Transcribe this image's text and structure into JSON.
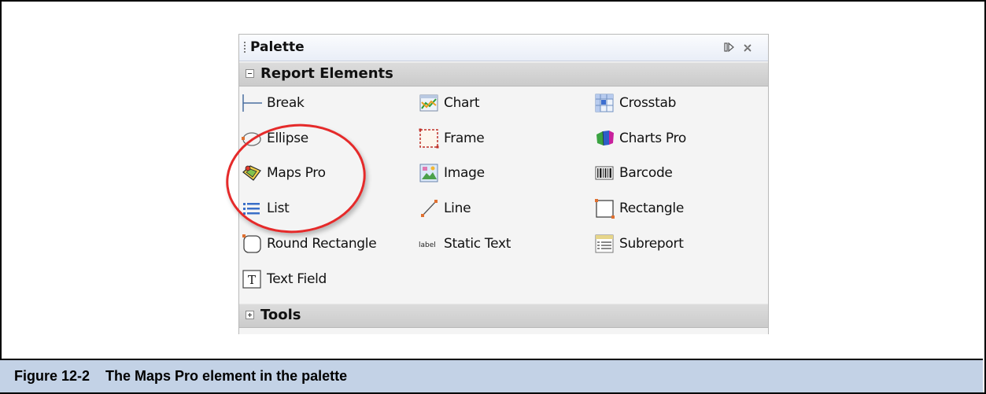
{
  "palette": {
    "title": "Palette",
    "sections": [
      {
        "label": "Report Elements",
        "expanded": true,
        "items": [
          {
            "label": "Break",
            "icon": "break-icon"
          },
          {
            "label": "Chart",
            "icon": "chart-icon"
          },
          {
            "label": "Crosstab",
            "icon": "crosstab-icon"
          },
          {
            "label": "Ellipse",
            "icon": "ellipse-icon"
          },
          {
            "label": "Frame",
            "icon": "frame-icon"
          },
          {
            "label": "Charts Pro",
            "icon": "charts-pro-icon"
          },
          {
            "label": "Maps Pro",
            "icon": "maps-pro-icon"
          },
          {
            "label": "Image",
            "icon": "image-icon"
          },
          {
            "label": "Barcode",
            "icon": "barcode-icon"
          },
          {
            "label": "List",
            "icon": "list-icon"
          },
          {
            "label": "Line",
            "icon": "line-icon"
          },
          {
            "label": "Rectangle",
            "icon": "rectangle-icon"
          },
          {
            "label": "Round Rectangle",
            "icon": "round-rectangle-icon"
          },
          {
            "label": "Static Text",
            "icon": "static-text-icon",
            "icon_text": "label"
          },
          {
            "label": "Subreport",
            "icon": "subreport-icon"
          },
          {
            "label": "Text Field",
            "icon": "text-field-icon",
            "icon_text": "T"
          }
        ]
      },
      {
        "label": "Tools",
        "expanded": false,
        "items": []
      }
    ]
  },
  "caption": {
    "text": "Figure 12-2    The Maps Pro element in the palette"
  },
  "colors": {
    "highlight": "#e52a2a",
    "caption_background": "#c3d2e6",
    "section_header": "#d4d4d4"
  }
}
